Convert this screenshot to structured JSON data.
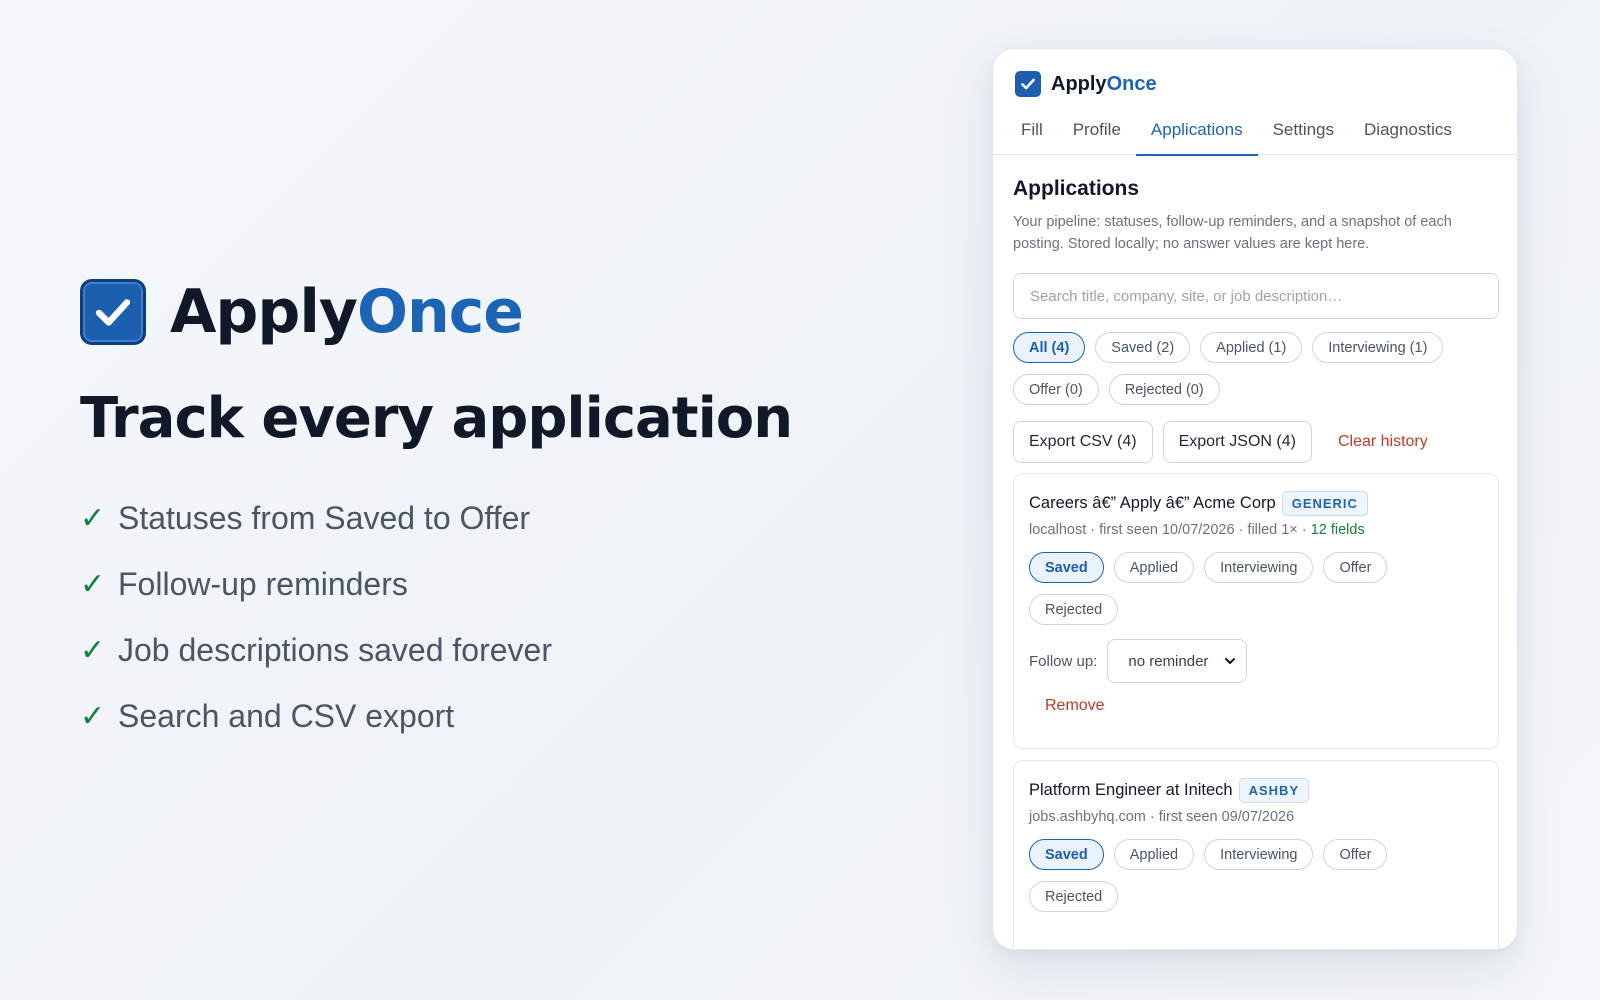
{
  "hero": {
    "brand_prefix": "Apply",
    "brand_suffix": "Once",
    "headline": "Track every application",
    "check_glyph": "✓",
    "features": [
      "Statuses from Saved to Offer",
      "Follow-up reminders",
      "Job descriptions saved forever",
      "Search and CSV export"
    ]
  },
  "panel": {
    "brand_prefix": "Apply",
    "brand_suffix": "Once",
    "tabs": [
      "Fill",
      "Profile",
      "Applications",
      "Settings",
      "Diagnostics"
    ],
    "active_tab": "Applications",
    "section_title": "Applications",
    "section_desc": "Your pipeline: statuses, follow-up reminders, and a snapshot of each posting. Stored locally; no answer values are kept here.",
    "search": {
      "placeholder": "Search title, company, site, or job description…",
      "value": ""
    },
    "filters": [
      "All (4)",
      "Saved (2)",
      "Applied (1)",
      "Interviewing (1)",
      "Offer (0)",
      "Rejected (0)"
    ],
    "active_filter": "All (4)",
    "actions": {
      "export_csv": "Export CSV (4)",
      "export_json": "Export JSON (4)",
      "clear_history": "Clear history"
    },
    "status_options": [
      "Saved",
      "Applied",
      "Interviewing",
      "Offer",
      "Rejected"
    ],
    "applications": [
      {
        "title": "Careers â€” Apply â€” Acme Corp",
        "badge": "GENERIC",
        "meta": "localhost · first seen 10/07/2026 · filled 1× · ",
        "fields": "12 fields",
        "status": "Saved",
        "followup_label": "Follow up:",
        "followup_value": "no reminder",
        "remove_label": "Remove"
      },
      {
        "title": "Platform Engineer at Initech",
        "badge": "ASHBY",
        "meta": "jobs.ashbyhq.com · first seen 09/07/2026",
        "status": "Saved"
      }
    ]
  },
  "colors": {
    "accent": "#1b64b6",
    "logo_bg": "#1b5fae",
    "check_green": "#15803d",
    "danger": "#c0392b"
  },
  "icons": {
    "logo": "checkbox-checked-icon",
    "feature": "checkmark-icon",
    "select": "chevron-down-icon"
  }
}
